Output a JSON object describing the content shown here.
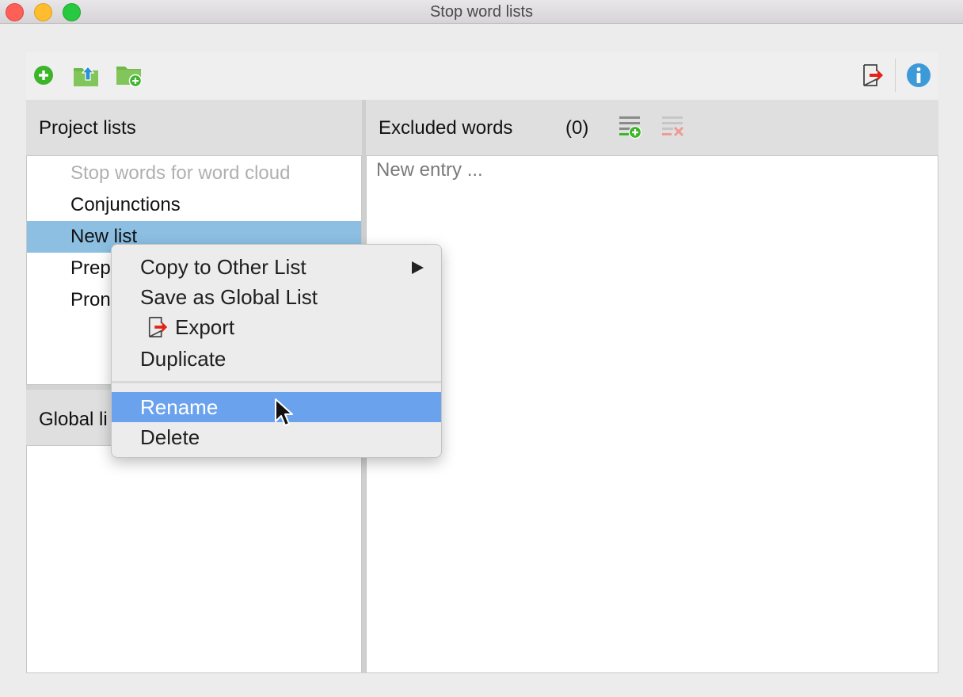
{
  "window": {
    "title": "Stop word lists"
  },
  "toolbar": {
    "buttons": [
      "add-icon",
      "import-list-icon",
      "new-folder-icon"
    ],
    "right_buttons": [
      "export-icon",
      "info-icon"
    ]
  },
  "project_panel": {
    "header": "Project lists",
    "items": [
      {
        "label": "Stop words for word cloud",
        "state": "disabled"
      },
      {
        "label": "Conjunctions",
        "state": "normal"
      },
      {
        "label": "New list",
        "state": "selected"
      },
      {
        "label": "Prep",
        "state": "normal"
      },
      {
        "label": "Pron",
        "state": "normal"
      }
    ]
  },
  "global_panel": {
    "header": "Global li"
  },
  "excluded_panel": {
    "header": "Excluded words",
    "count": "(0)",
    "placeholder": "New entry ..."
  },
  "context_menu": {
    "copy_to_other_list": "Copy to Other List",
    "save_as_global_list": "Save as Global List",
    "export": "Export",
    "duplicate": "Duplicate",
    "rename": "Rename",
    "delete": "Delete"
  },
  "colors": {
    "selection": "#8cbfe2",
    "menu_highlight": "#6ba2ee",
    "add_green": "#3cb528",
    "info_blue": "#3d9ad8",
    "export_red": "#e2231a"
  }
}
